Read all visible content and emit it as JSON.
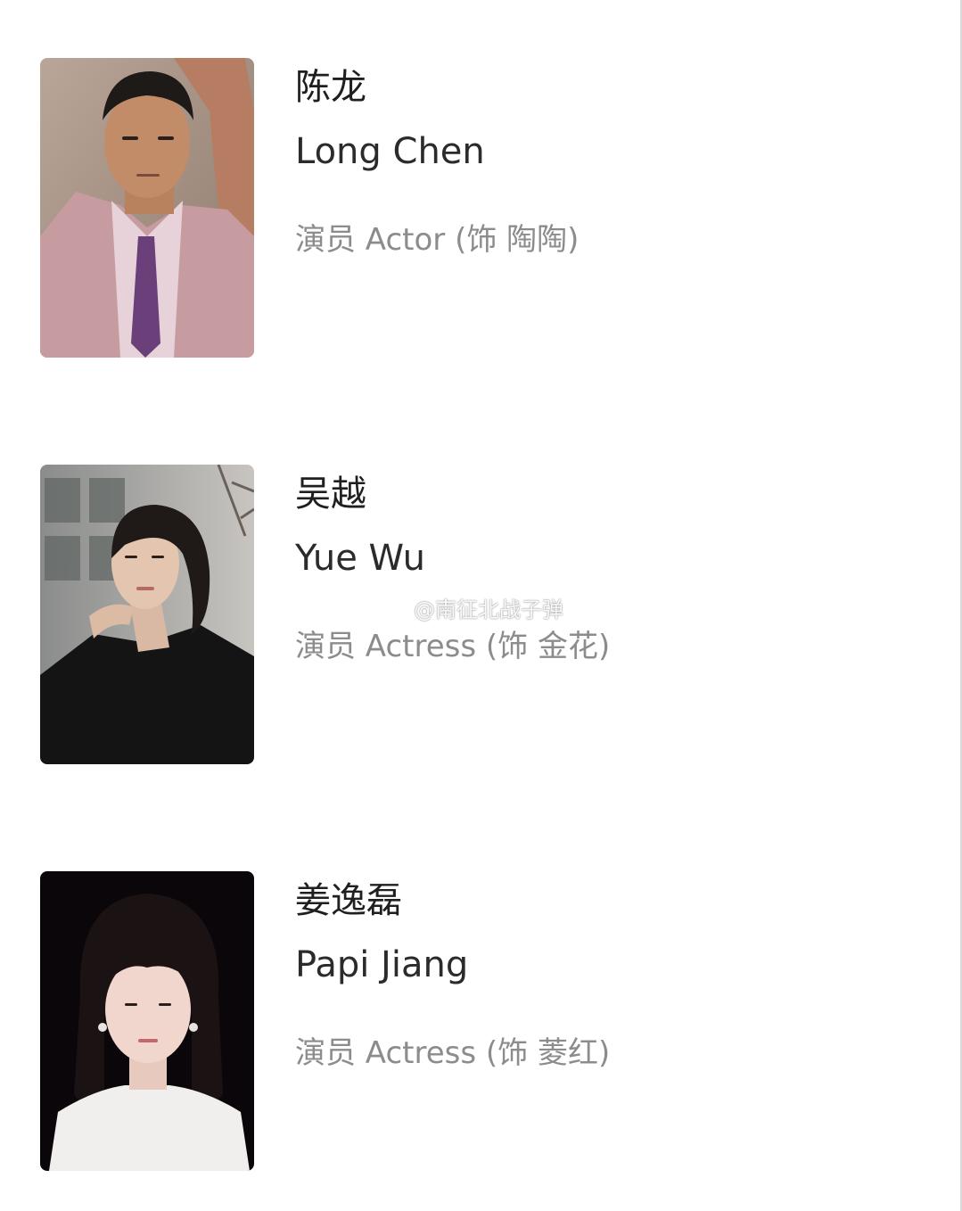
{
  "cast": [
    {
      "name_cn": "陈龙",
      "name_en": "Long Chen",
      "role": "演员 Actor (饰 陶陶)"
    },
    {
      "name_cn": "吴越",
      "name_en": "Yue Wu",
      "role": "演员 Actress (饰 金花)"
    },
    {
      "name_cn": "姜逸磊",
      "name_en": "Papi Jiang",
      "role": "演员 Actress (饰 菱红)"
    }
  ],
  "watermark": {
    "icon": "weibo-icon",
    "text": "@南征北战子弹"
  },
  "colors": {
    "name": "#1f1f1f",
    "role": "#8c8c8c",
    "background": "#ffffff"
  }
}
